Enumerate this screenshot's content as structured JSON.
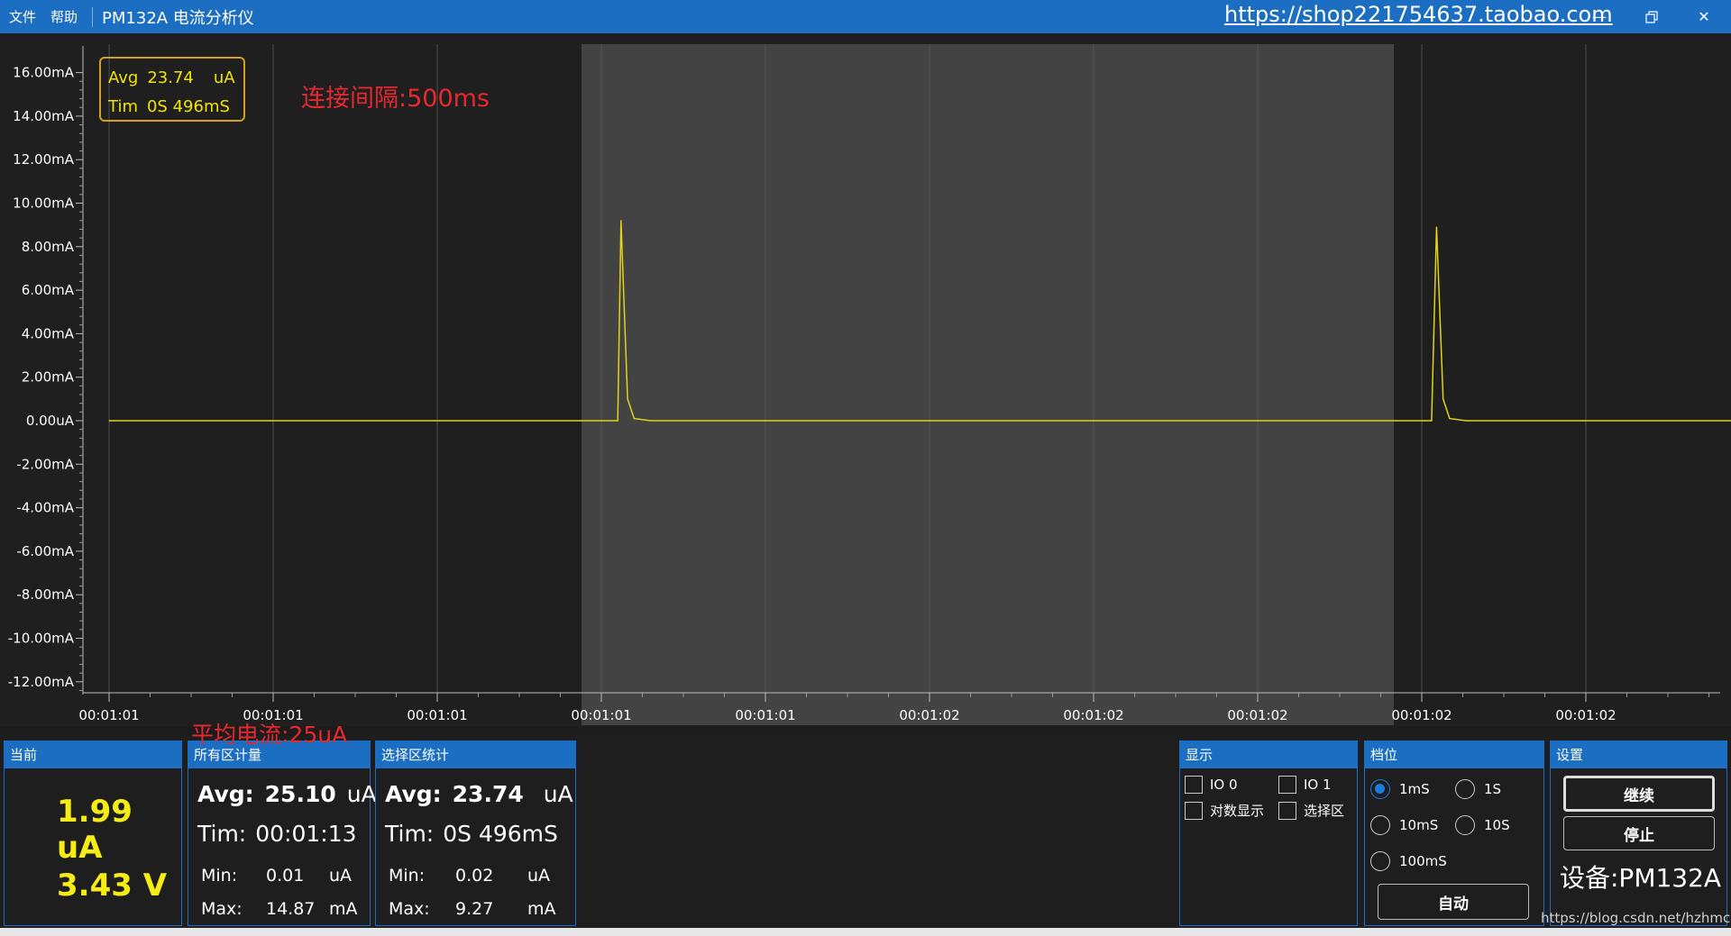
{
  "menu": {
    "file": "文件",
    "help": "帮助"
  },
  "window": {
    "title": "PM132A 电流分析仪",
    "shop_url": "https://shop221754637.taobao.com"
  },
  "plot": {
    "stat_box": {
      "avg_label": "Avg",
      "avg_value": "23.74",
      "avg_unit": "uA",
      "tim_label": "Tim",
      "tim_value": "0S 496mS"
    },
    "annotation_interval": "连接间隔:500ms",
    "annotation_avg": "平均电流:25uA"
  },
  "chart_data": {
    "type": "line",
    "y_tick_labels": [
      "16.00mA",
      "14.00mA",
      "12.00mA",
      "10.00mA",
      "8.00mA",
      "6.00mA",
      "4.00mA",
      "2.00mA",
      "0.00uA",
      "-2.00mA",
      "-4.00mA",
      "-6.00mA",
      "-8.00mA",
      "-10.00mA",
      "-12.00mA"
    ],
    "y_ticks_mA": [
      16,
      14,
      12,
      10,
      8,
      6,
      4,
      2,
      0,
      -2,
      -4,
      -6,
      -8,
      -10,
      -12
    ],
    "ylim_mA": [
      -12.3,
      17.3
    ],
    "x_tick_labels": [
      "00:01:01",
      "00:01:01",
      "00:01:01",
      "00:01:01",
      "00:01:01",
      "00:01:02",
      "00:01:02",
      "00:01:02",
      "00:01:02",
      "00:01:02"
    ],
    "selection_range": [
      3,
      8
    ],
    "series": [
      {
        "color": "#e2d21a",
        "x": [
          0,
          3.1,
          3.12,
          3.16,
          3.2,
          3.3,
          8.06,
          8.09,
          8.13,
          8.17,
          8.27,
          9.9
        ],
        "y_mA": [
          0,
          0,
          9.2,
          1.0,
          0.1,
          0,
          0,
          8.9,
          1.0,
          0.1,
          0,
          0
        ]
      }
    ],
    "grid": true,
    "colors": {
      "background": "#1f1f1f",
      "selection": "#474747",
      "grid": "#5a5a5a",
      "line": "#e2d21a"
    }
  },
  "panels": {
    "current": {
      "title": "当前",
      "current": "1.99 uA",
      "voltage": "3.43 V"
    },
    "all": {
      "title": "所有区计量",
      "avg_label": "Avg:",
      "avg_value": "25.10",
      "avg_unit": "uA",
      "tim_label": "Tim:",
      "tim_value": "00:01:13",
      "min_label": "Min:",
      "min_value": "0.01",
      "min_unit": "uA",
      "max_label": "Max:",
      "max_value": "14.87",
      "max_unit": "mA"
    },
    "selection": {
      "title": "选择区统计",
      "avg_label": "Avg:",
      "avg_value": "23.74",
      "avg_unit": "uA",
      "tim_label": "Tim:",
      "tim_value": "0S 496mS",
      "min_label": "Min:",
      "min_value": "0.02",
      "min_unit": "uA",
      "max_label": "Max:",
      "max_value": "9.27",
      "max_unit": "mA"
    },
    "display": {
      "title": "显示",
      "io0": "IO 0",
      "io1": "IO 1",
      "log": "对数显示",
      "select": "选择区"
    },
    "range": {
      "title": "档位",
      "r1ms": "1mS",
      "r1s": "1S",
      "r10ms": "10mS",
      "r10s": "10S",
      "r100ms": "100mS",
      "auto": "自动",
      "selected": "1mS"
    },
    "settings": {
      "title": "设置",
      "continue": "继续",
      "stop": "停止",
      "device": "设备:PM132A"
    }
  },
  "watermark": "https://blog.csdn.net/hzhmcu"
}
